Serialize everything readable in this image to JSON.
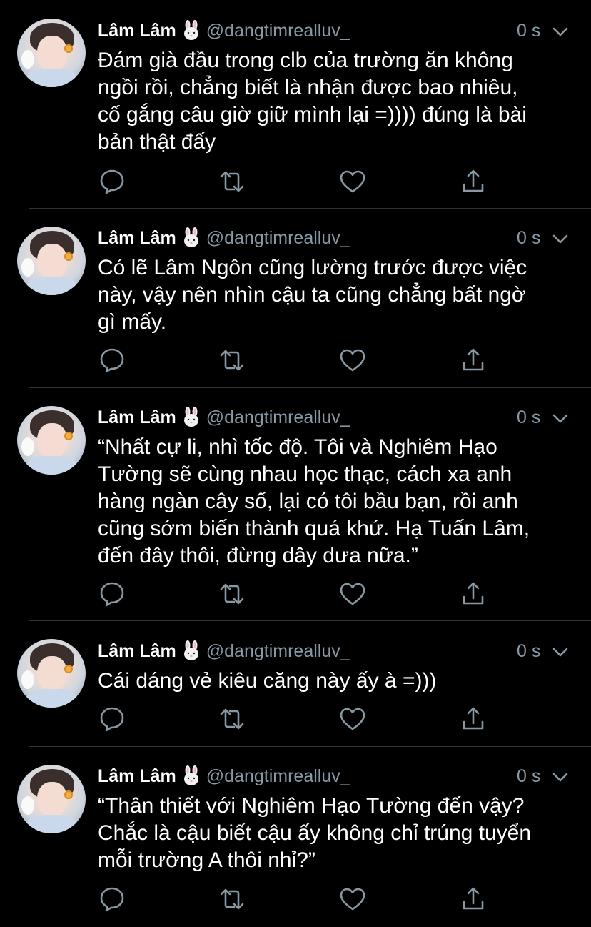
{
  "tweets": [
    {
      "name": "Lâm Lâm",
      "emoji": "rabbit-face-emoji",
      "handle": "@dangtimrealluv_",
      "time": "0 s",
      "text": "Đám già đầu trong clb của trường ăn không\nngồi rồi, chẳng biết là nhận được bao nhiêu,\ncố gắng câu giờ giữ mình lại =)))) đúng là bài\nbản thật đấy"
    },
    {
      "name": "Lâm Lâm",
      "emoji": "rabbit-face-emoji",
      "handle": "@dangtimrealluv_",
      "time": "0 s",
      "text": "Có lẽ Lâm Ngôn cũng lường trước được việc\nnày, vậy nên nhìn cậu ta cũng chẳng bất ngờ\ngì mấy."
    },
    {
      "name": "Lâm Lâm",
      "emoji": "rabbit-face-emoji",
      "handle": "@dangtimrealluv_",
      "time": "0 s",
      "text": "“Nhất cự li, nhì tốc độ. Tôi và Nghiêm Hạo\nTường sẽ cùng nhau học thạc, cách xa anh\nhàng ngàn cây số, lại có tôi bầu bạn, rồi anh\ncũng sớm biến thành quá khứ. Hạ Tuấn Lâm,\nđến đây thôi, đừng dây dưa nữa.”"
    },
    {
      "name": "Lâm Lâm",
      "emoji": "rabbit-face-emoji",
      "handle": "@dangtimrealluv_",
      "time": "0 s",
      "text": "Cái dáng vẻ kiêu căng này ấy à =)))"
    },
    {
      "name": "Lâm Lâm",
      "emoji": "rabbit-face-emoji",
      "handle": "@dangtimrealluv_",
      "time": "0 s",
      "text": "“Thân thiết với Nghiêm Hạo Tường đến vậy?\nChắc là cậu biết cậu ấy không chỉ trúng tuyển\nmỗi trường A thôi nhỉ?”"
    }
  ],
  "actions": [
    "reply-icon",
    "retweet-icon",
    "like-icon",
    "share-icon"
  ],
  "colors": {
    "background": "#000000",
    "text": "#ffffff",
    "secondary": "#8899a6",
    "divider": "#2f3336"
  }
}
